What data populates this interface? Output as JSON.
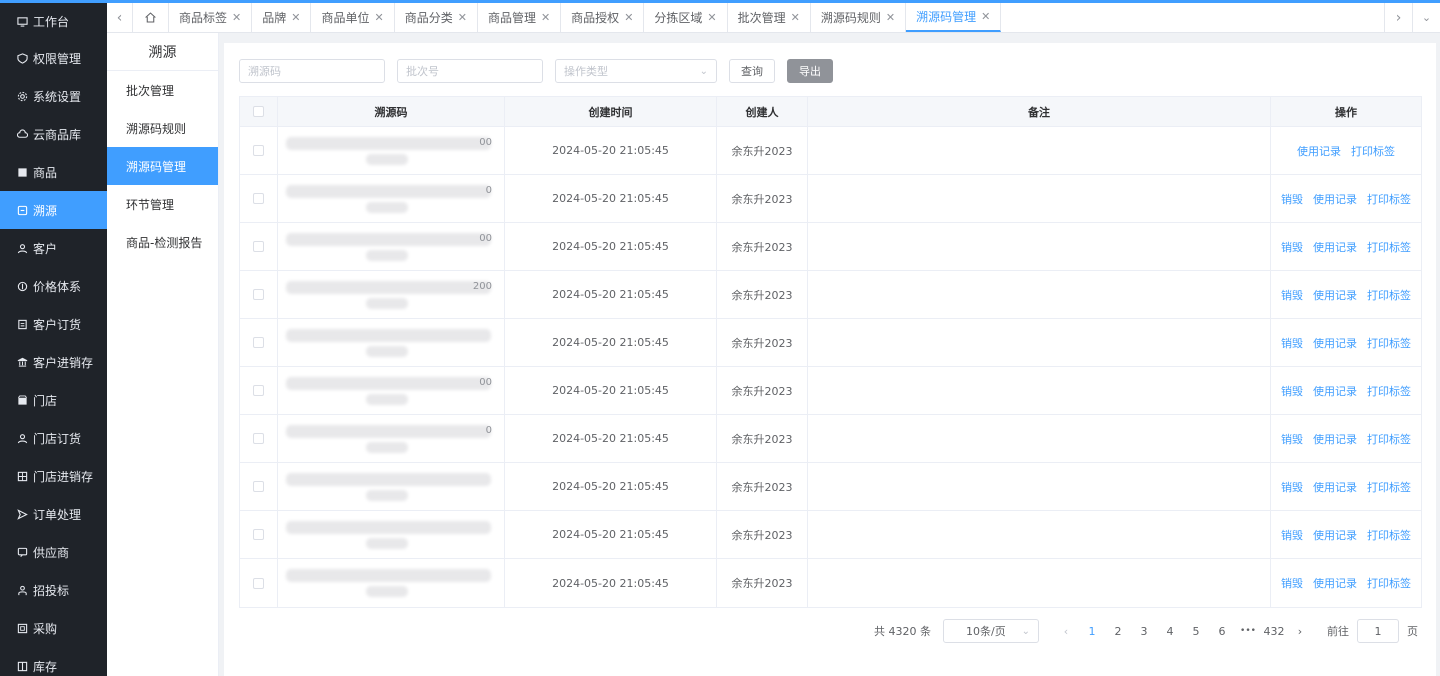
{
  "sidebar": {
    "items": [
      {
        "label": "工作台",
        "icon": "monitor-icon",
        "active": false
      },
      {
        "label": "权限管理",
        "icon": "shield-icon",
        "active": false
      },
      {
        "label": "系统设置",
        "icon": "gear-icon",
        "active": false
      },
      {
        "label": "云商品库",
        "icon": "cloud-icon",
        "active": false
      },
      {
        "label": "商品",
        "icon": "goods-icon",
        "active": false
      },
      {
        "label": "溯源",
        "icon": "trace-icon",
        "active": true
      },
      {
        "label": "客户",
        "icon": "user-icon",
        "active": false
      },
      {
        "label": "价格体系",
        "icon": "price-icon",
        "active": false
      },
      {
        "label": "客户订货",
        "icon": "order-icon",
        "active": false
      },
      {
        "label": "客户进销存",
        "icon": "bank-icon",
        "active": false
      },
      {
        "label": "门店",
        "icon": "store-icon",
        "active": false
      },
      {
        "label": "门店订货",
        "icon": "user-icon",
        "active": false
      },
      {
        "label": "门店进销存",
        "icon": "grid-icon",
        "active": false
      },
      {
        "label": "订单处理",
        "icon": "send-icon",
        "active": false
      },
      {
        "label": "供应商",
        "icon": "chat-icon",
        "active": false
      },
      {
        "label": "招投标",
        "icon": "person-icon",
        "active": false
      },
      {
        "label": "采购",
        "icon": "cart-icon",
        "active": false
      },
      {
        "label": "库存",
        "icon": "box-icon",
        "active": false
      }
    ]
  },
  "tabs": {
    "items": [
      {
        "label": "商品标签",
        "active": false
      },
      {
        "label": "品牌",
        "active": false
      },
      {
        "label": "商品单位",
        "active": false
      },
      {
        "label": "商品分类",
        "active": false
      },
      {
        "label": "商品管理",
        "active": false
      },
      {
        "label": "商品授权",
        "active": false
      },
      {
        "label": "分拣区域",
        "active": false
      },
      {
        "label": "批次管理",
        "active": false
      },
      {
        "label": "溯源码规则",
        "active": false
      },
      {
        "label": "溯源码管理",
        "active": true
      }
    ]
  },
  "subnav": {
    "title": "溯源",
    "items": [
      {
        "label": "批次管理",
        "active": false
      },
      {
        "label": "溯源码规则",
        "active": false
      },
      {
        "label": "溯源码管理",
        "active": true
      },
      {
        "label": "环节管理",
        "active": false
      },
      {
        "label": "商品-检测报告",
        "active": false
      }
    ]
  },
  "filters": {
    "code_placeholder": "溯源码",
    "batch_placeholder": "批次号",
    "op_type_placeholder": "操作类型",
    "query_label": "查询",
    "export_label": "导出"
  },
  "table": {
    "headers": {
      "code": "溯源码",
      "time": "创建时间",
      "creator": "创建人",
      "note": "备注",
      "ops": "操作"
    },
    "rows": [
      {
        "code_tail": "00",
        "time": "2024-05-20 21:05:45",
        "creator": "余东升2023",
        "note": "",
        "ops": [
          "使用记录",
          "打印标签"
        ]
      },
      {
        "code_tail": "0",
        "time": "2024-05-20 21:05:45",
        "creator": "余东升2023",
        "note": "",
        "ops": [
          "销毁",
          "使用记录",
          "打印标签"
        ]
      },
      {
        "code_tail": "00",
        "time": "2024-05-20 21:05:45",
        "creator": "余东升2023",
        "note": "",
        "ops": [
          "销毁",
          "使用记录",
          "打印标签"
        ]
      },
      {
        "code_tail": "200",
        "time": "2024-05-20 21:05:45",
        "creator": "余东升2023",
        "note": "",
        "ops": [
          "销毁",
          "使用记录",
          "打印标签"
        ]
      },
      {
        "code_tail": "",
        "time": "2024-05-20 21:05:45",
        "creator": "余东升2023",
        "note": "",
        "ops": [
          "销毁",
          "使用记录",
          "打印标签"
        ]
      },
      {
        "code_tail": "00",
        "time": "2024-05-20 21:05:45",
        "creator": "余东升2023",
        "note": "",
        "ops": [
          "销毁",
          "使用记录",
          "打印标签"
        ]
      },
      {
        "code_tail": "0",
        "time": "2024-05-20 21:05:45",
        "creator": "余东升2023",
        "note": "",
        "ops": [
          "销毁",
          "使用记录",
          "打印标签"
        ]
      },
      {
        "code_tail": "",
        "time": "2024-05-20 21:05:45",
        "creator": "余东升2023",
        "note": "",
        "ops": [
          "销毁",
          "使用记录",
          "打印标签"
        ]
      },
      {
        "code_tail": "",
        "time": "2024-05-20 21:05:45",
        "creator": "余东升2023",
        "note": "",
        "ops": [
          "销毁",
          "使用记录",
          "打印标签"
        ]
      },
      {
        "code_tail": "",
        "time": "2024-05-20 21:05:45",
        "creator": "余东升2023",
        "note": "",
        "ops": [
          "销毁",
          "使用记录",
          "打印标签"
        ]
      }
    ]
  },
  "pagination": {
    "total": "共 4320 条",
    "page_size": "10条/页",
    "pages": [
      "1",
      "2",
      "3",
      "4",
      "5",
      "6"
    ],
    "ellipsis": "•••",
    "last_page": "432",
    "current": "1",
    "goto_label": "前往",
    "goto_value": "1",
    "page_unit": "页"
  },
  "colors": {
    "accent": "#409eff",
    "sidebar_bg": "#1f2329"
  }
}
